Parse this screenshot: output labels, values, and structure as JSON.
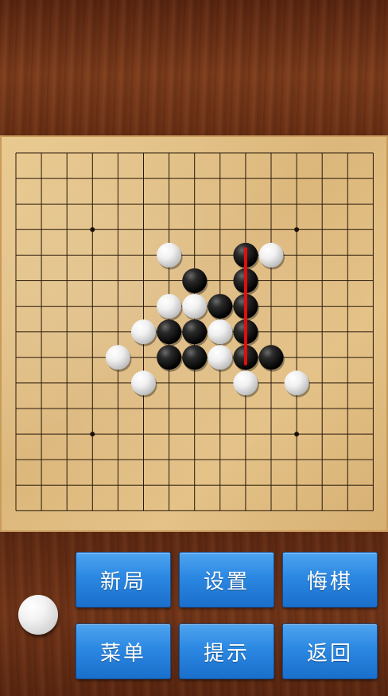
{
  "board": {
    "size": 15,
    "star_points": [
      [
        3,
        3
      ],
      [
        11,
        3
      ],
      [
        3,
        11
      ],
      [
        11,
        11
      ]
    ],
    "stones": [
      {
        "col": 6,
        "row": 4,
        "color": "white"
      },
      {
        "col": 9,
        "row": 4,
        "color": "black"
      },
      {
        "col": 10,
        "row": 4,
        "color": "white"
      },
      {
        "col": 7,
        "row": 5,
        "color": "black"
      },
      {
        "col": 9,
        "row": 5,
        "color": "black"
      },
      {
        "col": 6,
        "row": 6,
        "color": "white"
      },
      {
        "col": 7,
        "row": 6,
        "color": "white"
      },
      {
        "col": 8,
        "row": 6,
        "color": "black"
      },
      {
        "col": 9,
        "row": 6,
        "color": "black"
      },
      {
        "col": 5,
        "row": 7,
        "color": "white"
      },
      {
        "col": 6,
        "row": 7,
        "color": "black"
      },
      {
        "col": 7,
        "row": 7,
        "color": "black"
      },
      {
        "col": 8,
        "row": 7,
        "color": "white"
      },
      {
        "col": 9,
        "row": 7,
        "color": "black"
      },
      {
        "col": 4,
        "row": 8,
        "color": "white"
      },
      {
        "col": 6,
        "row": 8,
        "color": "black"
      },
      {
        "col": 7,
        "row": 8,
        "color": "black"
      },
      {
        "col": 8,
        "row": 8,
        "color": "white"
      },
      {
        "col": 9,
        "row": 8,
        "color": "black"
      },
      {
        "col": 10,
        "row": 8,
        "color": "black"
      },
      {
        "col": 5,
        "row": 9,
        "color": "white"
      },
      {
        "col": 9,
        "row": 9,
        "color": "white"
      },
      {
        "col": 11,
        "row": 9,
        "color": "white"
      }
    ],
    "winning_line": {
      "from": [
        9,
        4
      ],
      "to": [
        9,
        8
      ],
      "color": "#e01010"
    }
  },
  "turn_indicator": {
    "color": "white"
  },
  "buttons": {
    "new_game": "新局",
    "settings": "设置",
    "undo": "悔棋",
    "menu": "菜单",
    "hint": "提示",
    "back": "返回"
  }
}
